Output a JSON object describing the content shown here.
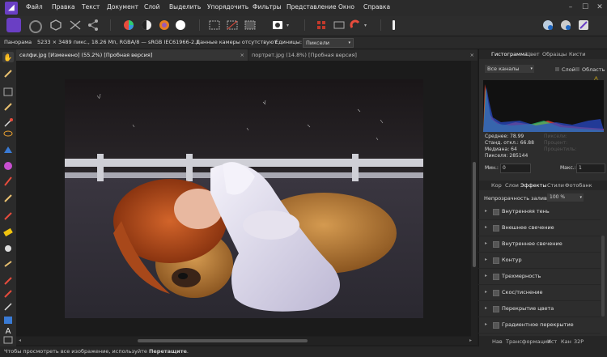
{
  "menubar": {
    "items": [
      "Файл",
      "Правка",
      "Текст",
      "Документ",
      "Слой",
      "Выделить",
      "Упорядочить",
      "Фильтры",
      "Представление",
      "Окно",
      "Справка"
    ]
  },
  "context": {
    "persona": "Панорама",
    "image_info": "5233 × 3489 пикс., 18.26 Мп, RGBA/8 — sRGB IEC61966-2.1",
    "camera": "Данные камеры отсутствуют",
    "units_label": "Единицы:",
    "units_value": "Пиксели"
  },
  "tabs": [
    {
      "label": "селфи.jpg [Изменено] (55.2%) [Пробная версия]",
      "close": "×"
    },
    {
      "label": "портрет.jpg (14.8%) [Пробная версия]",
      "close": "×"
    }
  ],
  "right_panel": {
    "tabs": [
      "Гистограмма",
      "Цвет",
      "Образцы",
      "Кисти"
    ],
    "channel": "Все каналы",
    "layer_label": "Слой",
    "area_label": "Область",
    "stats": [
      "Среднее: 78.99",
      "Станд. откл.: 66.88",
      "Медиана: 64",
      "Пикселя: 285144"
    ],
    "stats_faded": [
      "Пиксели:",
      "Процент:",
      "Процентиль:"
    ],
    "min_label": "Мин.:",
    "min_value": "0",
    "max_label": "Макс.:",
    "max_value": "1",
    "tabs2": [
      "Кор",
      "Слои",
      "Эффекты",
      "Стили",
      "Фотобанк"
    ],
    "opacity_label": "Непрозрачность заливки:",
    "opacity_value": "100 %",
    "effects": [
      "Внутренняя тень",
      "Внешнее свечение",
      "Внутреннее свечение",
      "Контур",
      "Трехмерность",
      "Скос/тиснение",
      "Перекрытие цвета",
      "Градиентное перекрытие"
    ],
    "bottom_tabs": [
      "Нав",
      "Трансформация",
      "Ист",
      "Кан",
      "32Р"
    ]
  },
  "status": {
    "text": "Чтобы просмотреть все изображение, используйте",
    "bold": "Перетащите"
  },
  "colors": {
    "accent": "#6a3fc4",
    "background": "#1e1e1e",
    "panel": "#2d2d2d"
  }
}
